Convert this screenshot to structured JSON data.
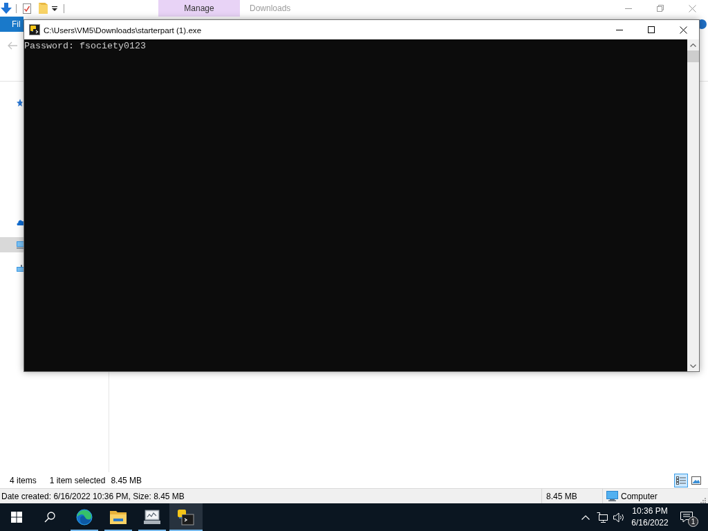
{
  "explorer": {
    "ribbon": {
      "context_group": "Manage",
      "window_title": "Downloads",
      "file_tab": "Fil"
    },
    "back_button": {
      "disabled": true
    },
    "nav_items": [
      {
        "kind": "quick-access",
        "selected": false
      },
      {
        "kind": "onedrive",
        "selected": false
      },
      {
        "kind": "pc",
        "selected": true
      },
      {
        "kind": "network",
        "selected": false
      }
    ],
    "status_bar": {
      "item_count": "4 items",
      "selection": "1 item selected",
      "selection_size": "8.45 MB"
    },
    "view_buttons": [
      {
        "kind": "details",
        "selected": true
      },
      {
        "kind": "large-icons",
        "selected": false
      }
    ],
    "details_bar": {
      "info": "Date created: 6/16/2022 10:36 PM, Size: 8.45 MB",
      "size": "8.45 MB",
      "location": "Computer"
    }
  },
  "console": {
    "title": "C:\\Users\\VM5\\Downloads\\starterpart (1).exe",
    "lines": [
      "Password: fsociety0123"
    ]
  },
  "taskbar": {
    "apps": [
      {
        "kind": "edge",
        "running": true,
        "selected": false
      },
      {
        "kind": "explorer",
        "running": true,
        "selected": false
      },
      {
        "kind": "monitor",
        "running": true,
        "selected": false
      },
      {
        "kind": "python-console",
        "running": true,
        "selected": true
      }
    ],
    "time": "10:36 PM",
    "date": "6/16/2022",
    "notification_count": "1"
  }
}
